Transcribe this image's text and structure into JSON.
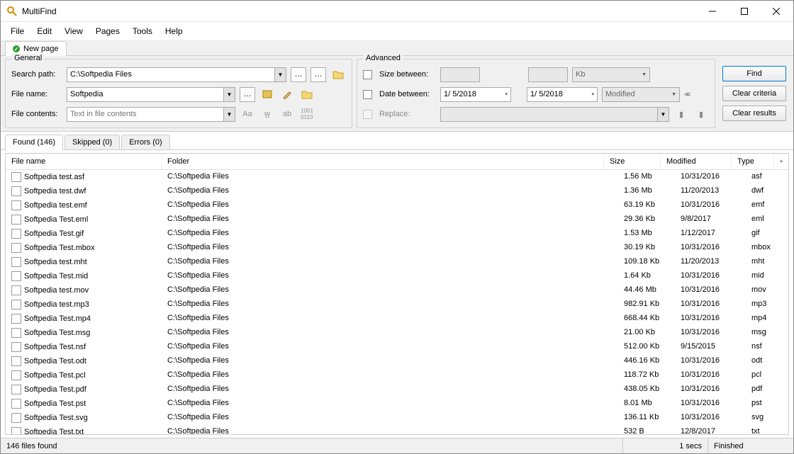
{
  "title": "MultiFind",
  "menus": [
    "File",
    "Edit",
    "View",
    "Pages",
    "Tools",
    "Help"
  ],
  "page_tab": "New page",
  "group_general": "General",
  "group_advanced": "Advanced",
  "labels": {
    "search_path": "Search path:",
    "file_name": "File name:",
    "file_contents": "File contents:",
    "size_between": "Size between:",
    "date_between": "Date between:",
    "replace": "Replace:"
  },
  "values": {
    "search_path": "C:\\Softpedia Files",
    "file_name": "Softpedia",
    "file_contents": "Text in file contents",
    "date1": "1/ 5/2018",
    "date2": "1/ 5/2018",
    "size_unit": "Kb",
    "date_kind": "Modified"
  },
  "buttons": {
    "find": "Find",
    "clear_criteria": "Clear criteria",
    "clear_results": "Clear results"
  },
  "result_tabs": {
    "found": "Found (146)",
    "skipped": "Skipped (0)",
    "errors": "Errors (0)"
  },
  "columns": {
    "name": "File name",
    "folder": "Folder",
    "size": "Size",
    "modified": "Modified",
    "type": "Type"
  },
  "rows": [
    {
      "name": "Softpedia test.asf",
      "folder": "C:\\Softpedia Files",
      "size": "1.56 Mb",
      "mod": "10/31/2016",
      "type": "asf"
    },
    {
      "name": "Softpedia test.dwf",
      "folder": "C:\\Softpedia Files",
      "size": "1.36 Mb",
      "mod": "11/20/2013",
      "type": "dwf"
    },
    {
      "name": "Softpedia test.emf",
      "folder": "C:\\Softpedia Files",
      "size": "63.19 Kb",
      "mod": "10/31/2016",
      "type": "emf"
    },
    {
      "name": "Softpedia Test.eml",
      "folder": "C:\\Softpedia Files",
      "size": "29.36 Kb",
      "mod": "9/8/2017",
      "type": "eml"
    },
    {
      "name": "Softpedia Test.gif",
      "folder": "C:\\Softpedia Files",
      "size": "1.53 Mb",
      "mod": "1/12/2017",
      "type": "gif"
    },
    {
      "name": "Softpedia Test.mbox",
      "folder": "C:\\Softpedia Files",
      "size": "30.19 Kb",
      "mod": "10/31/2016",
      "type": "mbox"
    },
    {
      "name": "Softpedia test.mht",
      "folder": "C:\\Softpedia Files",
      "size": "109.18 Kb",
      "mod": "11/20/2013",
      "type": "mht"
    },
    {
      "name": "Softpedia Test.mid",
      "folder": "C:\\Softpedia Files",
      "size": "1.64 Kb",
      "mod": "10/31/2016",
      "type": "mid"
    },
    {
      "name": "Softpedia test.mov",
      "folder": "C:\\Softpedia Files",
      "size": "44.46 Mb",
      "mod": "10/31/2016",
      "type": "mov"
    },
    {
      "name": "Softpedia test.mp3",
      "folder": "C:\\Softpedia Files",
      "size": "982.91 Kb",
      "mod": "10/31/2016",
      "type": "mp3"
    },
    {
      "name": "Softpedia Test.mp4",
      "folder": "C:\\Softpedia Files",
      "size": "668.44 Kb",
      "mod": "10/31/2016",
      "type": "mp4"
    },
    {
      "name": "Softpedia Test.msg",
      "folder": "C:\\Softpedia Files",
      "size": "21.00 Kb",
      "mod": "10/31/2016",
      "type": "msg"
    },
    {
      "name": "Softpedia Test.nsf",
      "folder": "C:\\Softpedia Files",
      "size": "512.00 Kb",
      "mod": "9/15/2015",
      "type": "nsf"
    },
    {
      "name": "Softpedia Test.odt",
      "folder": "C:\\Softpedia Files",
      "size": "446.16 Kb",
      "mod": "10/31/2016",
      "type": "odt"
    },
    {
      "name": "Softpedia Test.pcl",
      "folder": "C:\\Softpedia Files",
      "size": "118.72 Kb",
      "mod": "10/31/2016",
      "type": "pcl"
    },
    {
      "name": "Softpedia Test.pdf",
      "folder": "C:\\Softpedia Files",
      "size": "438.05 Kb",
      "mod": "10/31/2016",
      "type": "pdf"
    },
    {
      "name": "Softpedia Test.pst",
      "folder": "C:\\Softpedia Files",
      "size": "8.01 Mb",
      "mod": "10/31/2016",
      "type": "pst"
    },
    {
      "name": "Softpedia Test.svg",
      "folder": "C:\\Softpedia Files",
      "size": "136.11 Kb",
      "mod": "10/31/2016",
      "type": "svg"
    },
    {
      "name": "Softpedia Test.txt",
      "folder": "C:\\Softpedia Files",
      "size": "532 B",
      "mod": "12/8/2017",
      "type": "txt"
    }
  ],
  "status": {
    "found": "146 files found",
    "time": "1 secs",
    "state": "Finished"
  }
}
